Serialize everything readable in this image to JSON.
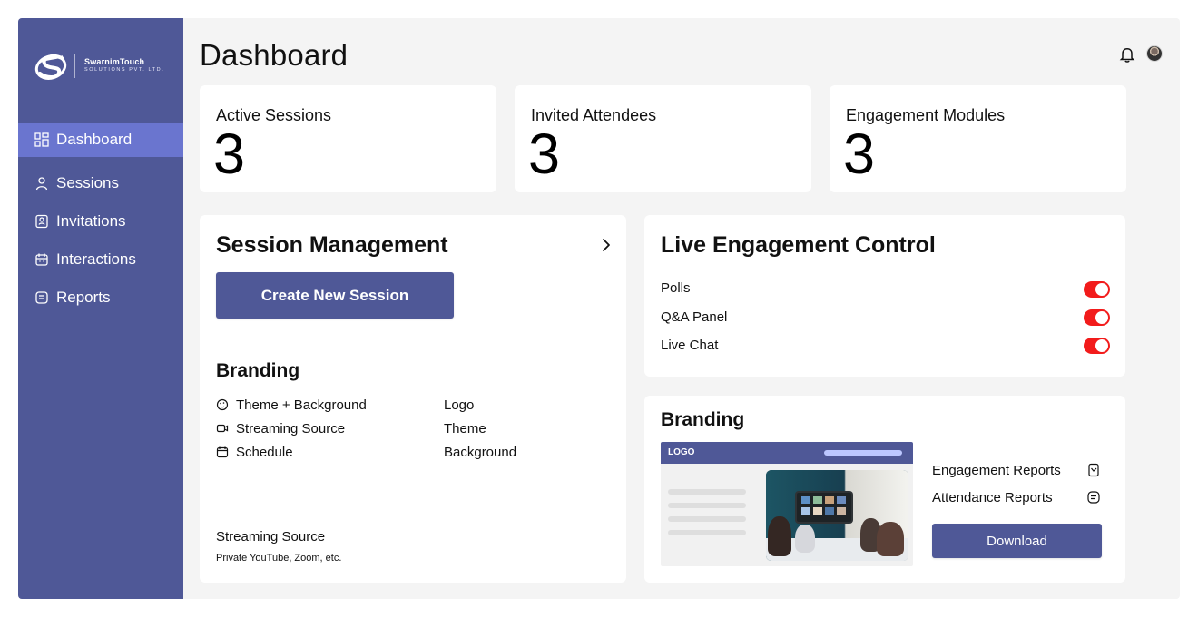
{
  "brand": {
    "name": "SwarnimTouch",
    "subtitle": "SOLUTIONS PVT. LTD.",
    "colors": {
      "sidebar": "#4f5897",
      "active_nav": "#6a75cf",
      "button": "#4f5897",
      "toggle_on": "#f21b1b",
      "background": "#f4f4f4"
    }
  },
  "header": {
    "title": "Dashboard",
    "notification_icon": "bell-icon",
    "avatar_icon": "avatar"
  },
  "sidebar": {
    "items": [
      {
        "label": "Dashboard",
        "icon": "dashboard-icon",
        "active": true
      },
      {
        "label": "Sessions",
        "icon": "user-icon",
        "active": false
      },
      {
        "label": "Invitations",
        "icon": "id-card-icon",
        "active": false
      },
      {
        "label": "Interactions",
        "icon": "calendar-icon",
        "active": false
      },
      {
        "label": "Reports",
        "icon": "document-icon",
        "active": false
      }
    ]
  },
  "stats": [
    {
      "label": "Active Sessions",
      "value": "3"
    },
    {
      "label": "Invited Attendees",
      "value": "3"
    },
    {
      "label": "Engagement Modules",
      "value": "3"
    }
  ],
  "session_management": {
    "title": "Session Management",
    "chevron_icon": "chevron-right-icon",
    "create_button": "Create New Session",
    "branding_title": "Branding",
    "branding_items": [
      {
        "label": "Theme + Background",
        "icon": "palette-icon"
      },
      {
        "label": "Streaming Source",
        "icon": "video-icon"
      },
      {
        "label": "Schedule",
        "icon": "calendar-icon"
      }
    ],
    "branding_values": [
      "Logo",
      "Theme",
      "Background"
    ],
    "streaming_source_title": "Streaming Source",
    "streaming_source_note": "Private YouTube, Zoom, etc."
  },
  "live_engagement": {
    "title": "Live Engagement Control",
    "controls": [
      {
        "label": "Polls",
        "enabled": true
      },
      {
        "label": "Q&A Panel",
        "enabled": true
      },
      {
        "label": "Live Chat",
        "enabled": true
      }
    ]
  },
  "branding_preview": {
    "title": "Branding",
    "logo_text": "LOGO",
    "reports": [
      {
        "label": "Engagement Reports",
        "icon": "bookmark-icon"
      },
      {
        "label": "Attendance Reports",
        "icon": "document-icon"
      }
    ],
    "download_button": "Download"
  }
}
